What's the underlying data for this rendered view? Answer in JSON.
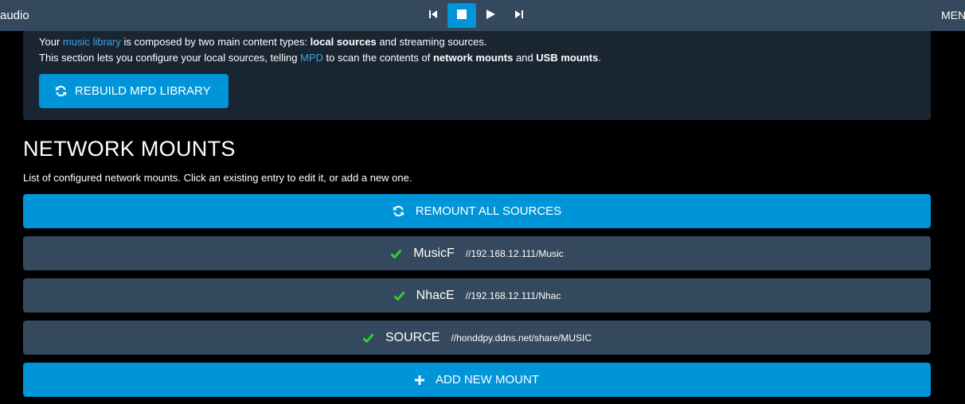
{
  "app": {
    "brand": "audio",
    "menu_label": "MENU"
  },
  "transport": {
    "buttons": [
      {
        "name": "previous",
        "icon": "skip-back-icon"
      },
      {
        "name": "stop",
        "icon": "stop-icon",
        "active": true
      },
      {
        "name": "play",
        "icon": "play-icon"
      },
      {
        "name": "next",
        "icon": "skip-forward-icon"
      }
    ]
  },
  "intro": {
    "line1": {
      "p1": "Your ",
      "link": "music library",
      "p2": " is composed by two main content types: ",
      "b1": "local sources",
      "p3": " and streaming sources."
    },
    "line2": {
      "p1": "This section lets you configure your local sources, telling ",
      "link": "MPD",
      "p2": " to scan the contents of ",
      "b1": "network mounts",
      "p3": " and ",
      "b2": "USB mounts",
      "p4": "."
    },
    "rebuild_label": "REBUILD MPD LIBRARY"
  },
  "network": {
    "title": "NETWORK MOUNTS",
    "description": "List of configured network mounts. Click an existing entry to edit it, or add a new one.",
    "remount_label": "REMOUNT ALL SOURCES",
    "mounts": [
      {
        "name": "MusicF",
        "path": "//192.168.12.111/Music",
        "status": "ok"
      },
      {
        "name": "NhacE",
        "path": "//192.168.12.111/Nhac",
        "status": "ok"
      },
      {
        "name": "SOURCE",
        "path": "//honddpy.ddns.net/share/MUSIC",
        "status": "ok"
      }
    ],
    "add_label": "ADD NEW MOUNT"
  },
  "colors": {
    "topbar": "#34495e",
    "accent": "#0095d9",
    "panel": "#1a2532",
    "row": "#34495e",
    "link": "#3aa3e3",
    "check": "#33cc33"
  }
}
